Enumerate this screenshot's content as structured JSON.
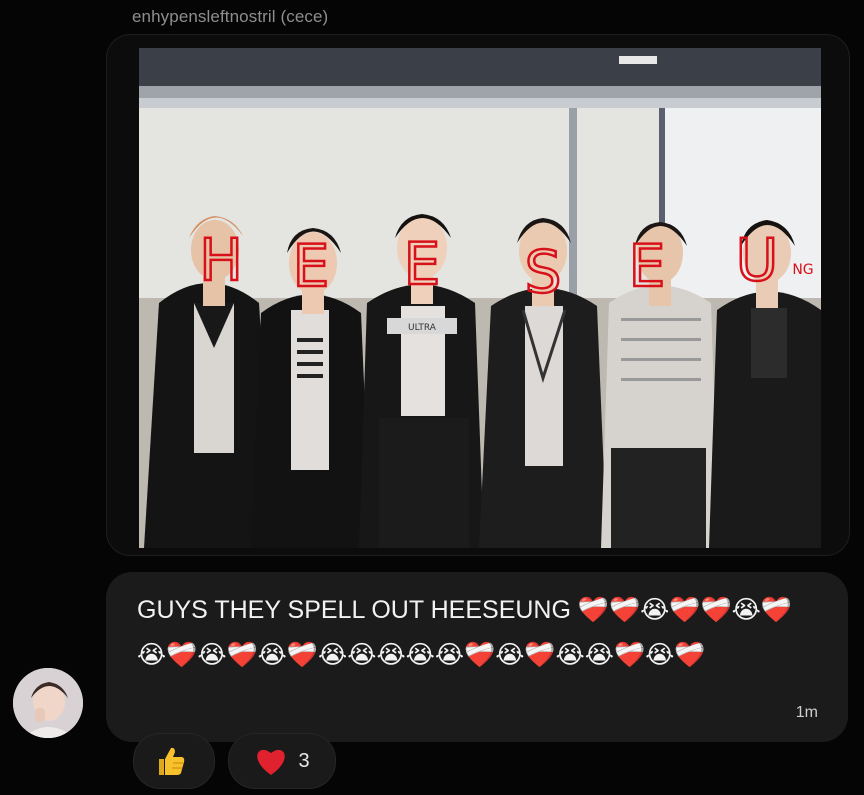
{
  "message": {
    "sender_name": "enhypensleftnostril (cece)",
    "text": "GUYS THEY SPELL OUT HEESEUNG ❤️‍🩹❤️‍🩹😭❤️‍🩹❤️‍🩹😭❤️‍🩹😭❤️‍🩹😭❤️‍🩹😭❤️‍🩹😭😭😭😭😭❤️‍🩹😭❤️‍🩹😭😭❤️‍🩹😭❤️‍🩹",
    "timestamp": "1m"
  },
  "photo": {
    "annotation_letters": [
      "H",
      "E",
      "E",
      "S",
      "E",
      "U"
    ],
    "annotation_suffix": "NG",
    "shirt_text": "ULTRA"
  },
  "reactions": [
    {
      "emoji": "thumbs-up",
      "count": ""
    },
    {
      "emoji": "heart",
      "count": "3"
    }
  ],
  "colors": {
    "background": "#050505",
    "bubble": "#1b1b1b",
    "annotation_red": "#d8101a",
    "heart": "#e0212e"
  }
}
